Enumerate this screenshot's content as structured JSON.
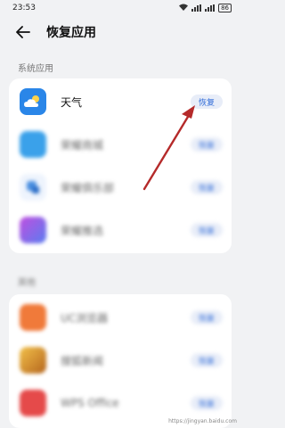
{
  "status_bar": {
    "time": "23:53",
    "battery": "86"
  },
  "header": {
    "title": "恢复应用"
  },
  "sections": {
    "system": {
      "label": "系统应用",
      "apps": [
        {
          "name": "天气",
          "button": "恢复",
          "icon": "weather-app-icon",
          "color": "#2a86e8"
        },
        {
          "name": "荣耀商城",
          "button": "恢复",
          "icon": "mall-app-icon",
          "color": "#3aa1ea"
        },
        {
          "name": "荣耀俱乐部",
          "button": "恢复",
          "icon": "club-app-icon",
          "color": "#4a8fe0"
        },
        {
          "name": "荣耀推选",
          "button": "恢复",
          "icon": "recommend-app-icon",
          "color": "#8f5fe6"
        }
      ]
    },
    "other": {
      "label": "其他",
      "apps": [
        {
          "name": "UC浏览器",
          "button": "恢复",
          "icon": "uc-browser-icon",
          "color": "#f07a3a"
        },
        {
          "name": "搜狐新闻",
          "button": "恢复",
          "icon": "news-app-icon",
          "color": "#e0a030"
        },
        {
          "name": "WPS Office",
          "button": "恢复",
          "icon": "wps-office-icon",
          "color": "#e54a4a"
        }
      ]
    }
  },
  "watermark": "https://jingyan.baidu.com"
}
